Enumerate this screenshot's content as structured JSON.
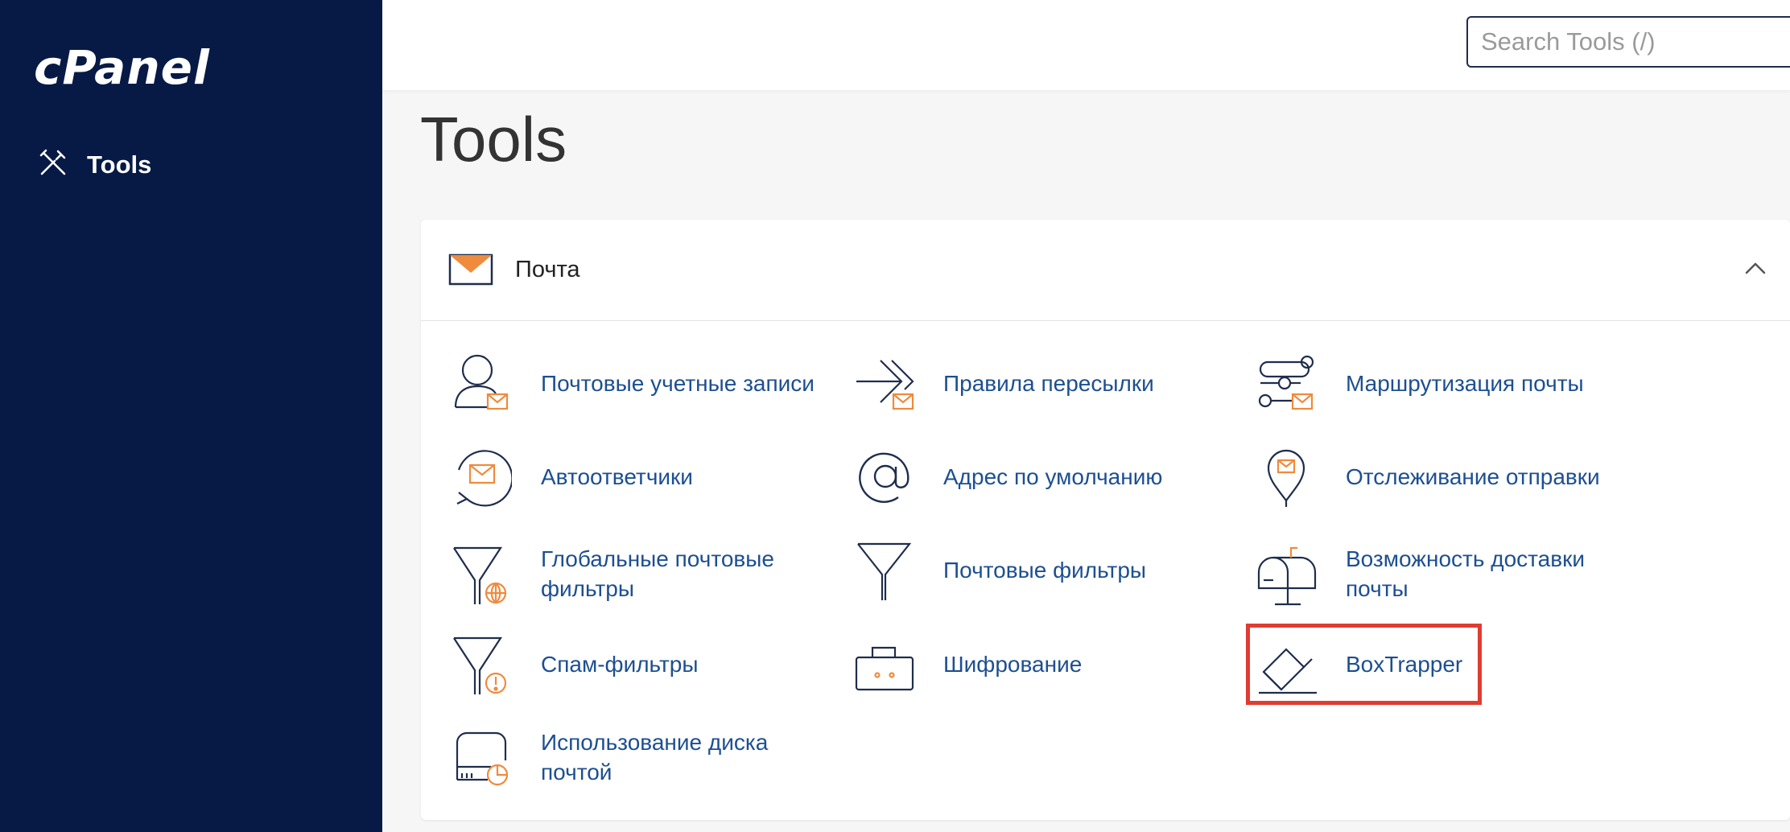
{
  "brand": {
    "logo_text": "cPanel"
  },
  "sidebar": {
    "items": [
      {
        "label": "Tools",
        "icon": "tools-icon"
      }
    ]
  },
  "header": {
    "search_placeholder": "Search Tools (/)"
  },
  "page": {
    "title": "Tools"
  },
  "section": {
    "title": "Почта",
    "icon": "envelope-icon",
    "collapse_icon": "chevron-up-icon",
    "tools": [
      {
        "label": "Почтовые учетные записи",
        "icon": "email-accounts-icon"
      },
      {
        "label": "Правила пересылки",
        "icon": "forwarders-icon"
      },
      {
        "label": "Маршрутизация почты",
        "icon": "email-routing-icon"
      },
      {
        "label": "Автоответчики",
        "icon": "autoresponders-icon"
      },
      {
        "label": "Адрес по умолчанию",
        "icon": "default-address-icon"
      },
      {
        "label": "Отслеживание отправки",
        "icon": "track-delivery-icon"
      },
      {
        "label": "Глобальные почтовые фильтры",
        "icon": "global-email-filters-icon"
      },
      {
        "label": "Почтовые фильтры",
        "icon": "email-filters-icon"
      },
      {
        "label": "Возможность доставки почты",
        "icon": "email-deliverability-icon"
      },
      {
        "label": "Спам-фильтры",
        "icon": "spam-filters-icon"
      },
      {
        "label": "Шифрование",
        "icon": "encryption-icon"
      },
      {
        "label": "BoxTrapper",
        "icon": "boxtrapper-icon"
      },
      {
        "label": "Использование диска почтой",
        "icon": "email-disk-usage-icon"
      }
    ]
  },
  "colors": {
    "sidebar_bg": "#071a45",
    "link": "#1d4f91",
    "accent": "#f08a3c",
    "highlight": "#e03c32"
  }
}
